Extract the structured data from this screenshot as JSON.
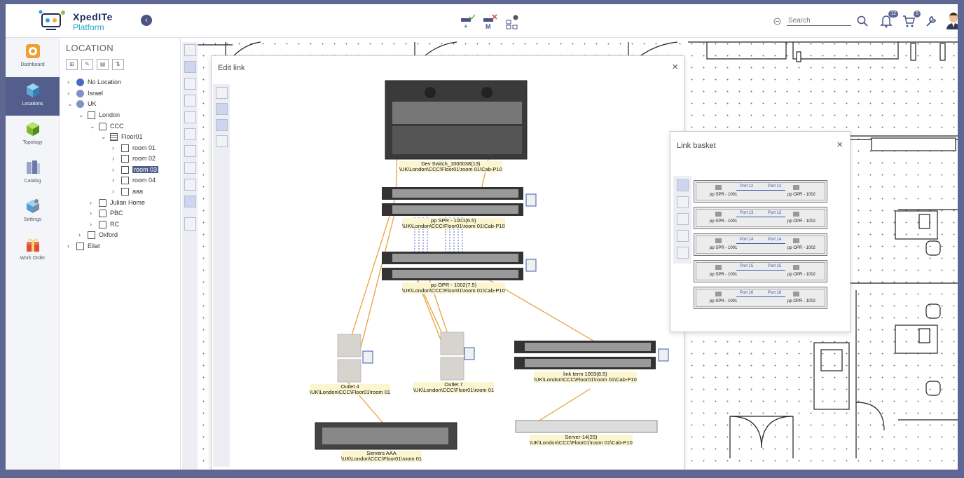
{
  "header": {
    "logo_title": "XpedITe",
    "logo_subtitle": "Platform",
    "search_placeholder": "Search",
    "notifications_count": "12",
    "cart_count": "5",
    "icons": [
      "collapse-icon",
      "add-link-icon",
      "remove-link-icon",
      "topology-icon",
      "zoom-out-icon",
      "search-icon",
      "bell-icon",
      "cart-icon",
      "wrench-icon",
      "avatar"
    ]
  },
  "leftnav": {
    "items": [
      {
        "label": "Dashboard"
      },
      {
        "label": "Locations"
      },
      {
        "label": "Topology"
      },
      {
        "label": "Catalog"
      },
      {
        "label": "Settings"
      },
      {
        "label": "Work Order"
      }
    ]
  },
  "location": {
    "title": "LOCATION",
    "tree": [
      {
        "label": "No Location"
      },
      {
        "label": "Israel"
      },
      {
        "label": "UK"
      },
      {
        "label": "London"
      },
      {
        "label": "CCC"
      },
      {
        "label": "Floor01"
      },
      {
        "label": "room 01"
      },
      {
        "label": "room 02"
      },
      {
        "label": "room 03"
      },
      {
        "label": "room 04"
      },
      {
        "label": "aaa"
      },
      {
        "label": "Julian Home"
      },
      {
        "label": "PBC"
      },
      {
        "label": "RC"
      },
      {
        "label": "Oxford"
      },
      {
        "label": "Eilat"
      }
    ]
  },
  "edit_link": {
    "title": "Edit link",
    "close": "×",
    "nodes": [
      {
        "name": "Dev Switch_1000038(13)",
        "path": "\\UK\\London\\CCC\\Floor01\\room 01\\Cab-P10"
      },
      {
        "name": "pp SPR - 1001(6.5)",
        "path": "\\UK\\London\\CCC\\Floor01\\room 01\\Cab-P10"
      },
      {
        "name": "pp OPR - 1002(7.5)",
        "path": "\\UK\\London\\CCC\\Floor01\\room 01\\Cab-P10"
      },
      {
        "name": "Outlet 4",
        "path": "\\UK\\London\\CCC\\Floor01\\room 01"
      },
      {
        "name": "Outlet 7",
        "path": "\\UK\\London\\CCC\\Floor01\\room 01"
      },
      {
        "name": "link term 1003(8.5)",
        "path": "\\UK\\London\\CCC\\Floor01\\room 01\\Cab-P10"
      },
      {
        "name": "Servers AAA",
        "path": "\\UK\\London\\CCC\\Floor01\\room 01"
      },
      {
        "name": "Server-14(25)",
        "path": "\\UK\\London\\CCC\\Floor01\\room 01\\Cab-P10"
      }
    ]
  },
  "link_basket": {
    "title": "Link basket",
    "close": "×",
    "rows": [
      {
        "left": "pp SPR - 1001",
        "port_left": "Port 12",
        "port_right": "Port 12",
        "right": "pp OPR - 1002"
      },
      {
        "left": "pp SPR - 1001",
        "port_left": "Port 13",
        "port_right": "Port 13",
        "right": "pp OPR - 1002"
      },
      {
        "left": "pp SPR - 1001",
        "port_left": "Port 14",
        "port_right": "Port 14",
        "right": "pp OPR - 1002"
      },
      {
        "left": "pp SPR - 1001",
        "port_left": "Port 15",
        "port_right": "Port 15",
        "right": "pp OPR - 1002"
      },
      {
        "left": "pp SPR - 1001",
        "port_left": "Port 16",
        "port_right": "Port 16",
        "right": "pp OPR - 1002"
      }
    ]
  }
}
